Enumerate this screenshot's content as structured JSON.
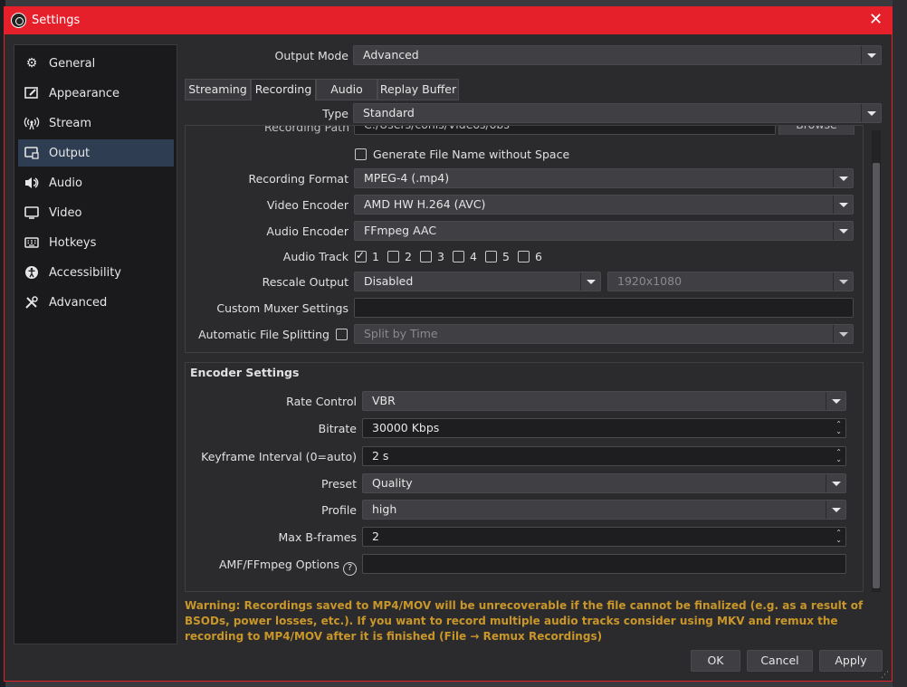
{
  "window": {
    "title": "Settings",
    "close_icon": "close-icon"
  },
  "sidebar": {
    "items": [
      {
        "label": "General",
        "icon": "gear-icon"
      },
      {
        "label": "Appearance",
        "icon": "appearance-icon"
      },
      {
        "label": "Stream",
        "icon": "broadcast-icon"
      },
      {
        "label": "Output",
        "icon": "monitor-icon"
      },
      {
        "label": "Audio",
        "icon": "speaker-icon"
      },
      {
        "label": "Video",
        "icon": "screen-icon"
      },
      {
        "label": "Hotkeys",
        "icon": "keyboard-icon"
      },
      {
        "label": "Accessibility",
        "icon": "accessibility-icon"
      },
      {
        "label": "Advanced",
        "icon": "tools-icon"
      }
    ],
    "active": "Output"
  },
  "output_mode": {
    "label": "Output Mode",
    "value": "Advanced"
  },
  "tabs": [
    {
      "label": "Streaming"
    },
    {
      "label": "Recording"
    },
    {
      "label": "Audio"
    },
    {
      "label": "Replay Buffer"
    }
  ],
  "active_tab": "Recording",
  "type": {
    "label": "Type",
    "value": "Standard"
  },
  "recording": {
    "path_label": "Recording Path",
    "path_value": "C:/Users/conis/Videos/obs",
    "browse_label": "Browse",
    "gen_filename_label": "Generate File Name without Space",
    "format_label": "Recording Format",
    "format_value": "MPEG-4 (.mp4)",
    "video_encoder_label": "Video Encoder",
    "video_encoder_value": "AMD HW H.264 (AVC)",
    "audio_encoder_label": "Audio Encoder",
    "audio_encoder_value": "FFmpeg AAC",
    "audio_track_label": "Audio Track",
    "tracks": [
      {
        "label": "1",
        "checked": true
      },
      {
        "label": "2",
        "checked": false
      },
      {
        "label": "3",
        "checked": false
      },
      {
        "label": "4",
        "checked": false
      },
      {
        "label": "5",
        "checked": false
      },
      {
        "label": "6",
        "checked": false
      }
    ],
    "rescale_label": "Rescale Output",
    "rescale_value": "Disabled",
    "rescale_resolution": "1920x1080",
    "muxer_label": "Custom Muxer Settings",
    "muxer_value": "",
    "split_label": "Automatic File Splitting",
    "split_value": "Split by Time"
  },
  "encoder": {
    "title": "Encoder Settings",
    "rate_control_label": "Rate Control",
    "rate_control_value": "VBR",
    "bitrate_label": "Bitrate",
    "bitrate_value": "30000 Kbps",
    "keyframe_label": "Keyframe Interval (0=auto)",
    "keyframe_value": "2 s",
    "preset_label": "Preset",
    "preset_value": "Quality",
    "profile_label": "Profile",
    "profile_value": "high",
    "bframes_label": "Max B-frames",
    "bframes_value": "2",
    "amf_label": "AMF/FFmpeg Options",
    "amf_value": ""
  },
  "warning": "Warning: Recordings saved to MP4/MOV will be unrecoverable if the file cannot be finalized (e.g. as a result of BSODs, power losses, etc.). If you want to record multiple audio tracks consider using MKV and remux the recording to MP4/MOV after it is finished (File → Remux Recordings)",
  "buttons": {
    "ok": "OK",
    "cancel": "Cancel",
    "apply": "Apply"
  },
  "colors": {
    "title_bar": "#e5202a",
    "warning": "#c9962a",
    "active_item": "#2f3d52"
  }
}
